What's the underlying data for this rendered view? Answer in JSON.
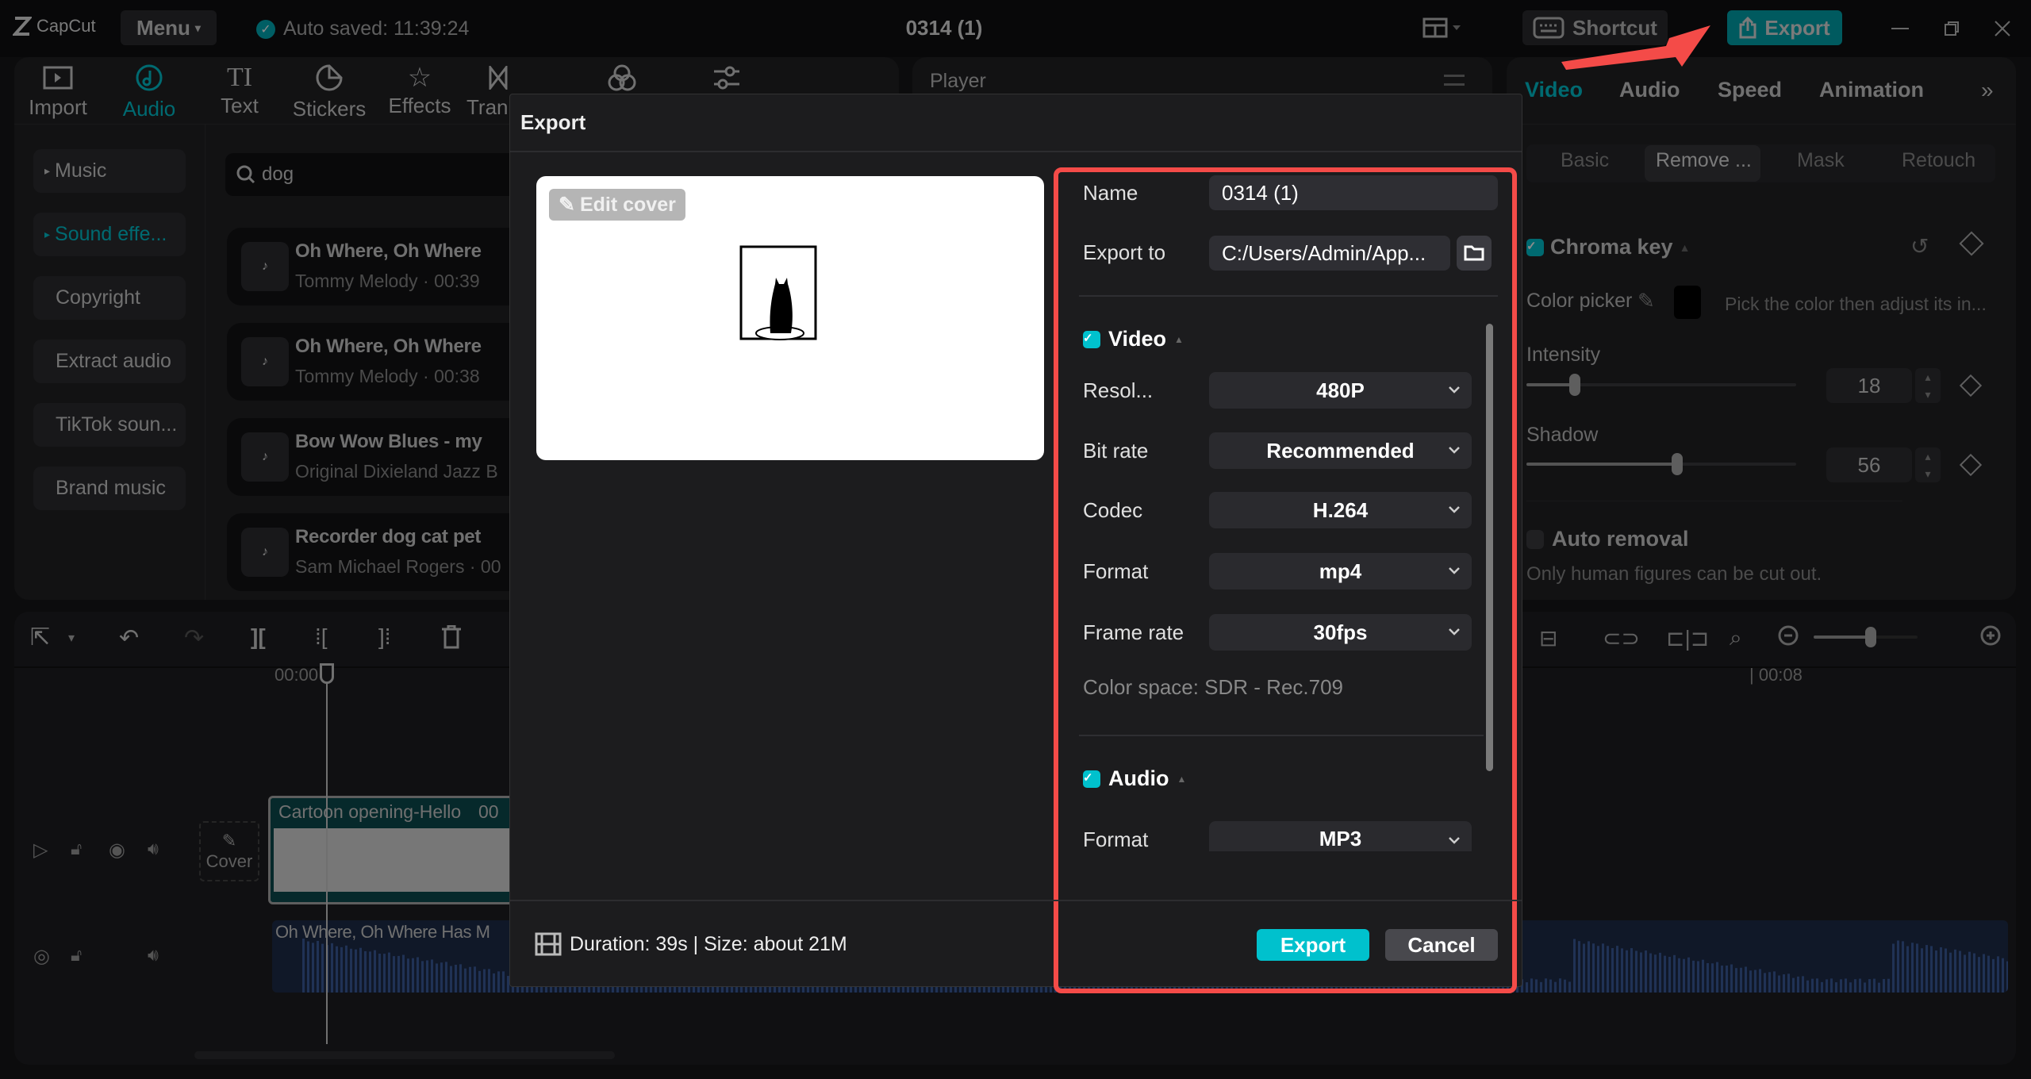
{
  "app": {
    "logo": "CapCut",
    "menu_label": "Menu",
    "autosave": "Auto saved: 11:39:24",
    "project_title": "0314 (1)",
    "shortcut_label": "Shortcut",
    "export_label": "Export",
    "accent": "#00c1cd",
    "annotation_color": "#f44b48"
  },
  "toolbar_tabs": [
    {
      "label": "Import",
      "icon": "import-icon"
    },
    {
      "label": "Audio",
      "icon": "audio-icon",
      "active": true
    },
    {
      "label": "Text",
      "icon": "text-icon"
    },
    {
      "label": "Stickers",
      "icon": "stickers-icon"
    },
    {
      "label": "Effects",
      "icon": "effects-icon"
    },
    {
      "label": "Tran",
      "icon": "transitions-icon"
    },
    {
      "label": "",
      "icon": "filters-icon"
    },
    {
      "label": "",
      "icon": "adjust-icon"
    }
  ],
  "sidebar": {
    "items": [
      {
        "label": "Music"
      },
      {
        "label": "Sound effe...",
        "active": true
      },
      {
        "label": "Copyright"
      },
      {
        "label": "Extract audio"
      },
      {
        "label": "TikTok soun..."
      },
      {
        "label": "Brand music"
      }
    ]
  },
  "search": {
    "value": "dog"
  },
  "music_list": [
    {
      "title": "Oh Where, Oh Where",
      "subtitle": "Tommy Melody · 00:39"
    },
    {
      "title": "Oh Where, Oh Where",
      "subtitle": "Tommy Melody · 00:38"
    },
    {
      "title": "Bow Wow Blues  - my",
      "subtitle": "Original Dixieland Jazz B"
    },
    {
      "title": "Recorder dog cat pet",
      "subtitle": "Sam Michael Rogers · 00"
    }
  ],
  "player": {
    "label": "Player"
  },
  "right_panel": {
    "tabs": [
      "Video",
      "Audio",
      "Speed",
      "Animation"
    ],
    "subtabs": [
      "Basic",
      "Remove ...",
      "Mask",
      "Retouch"
    ],
    "chroma_key": "Chroma key",
    "color_picker": "Color picker",
    "picker_hint": "Pick the color then adjust its in...",
    "intensity_label": "Intensity",
    "intensity": 18,
    "shadow_label": "Shadow",
    "shadow": 56,
    "auto_removal": "Auto removal",
    "auto_note": "Only human figures can be cut out."
  },
  "timeline": {
    "ruler_start": "00:00",
    "ruler_mark": "| 00:08",
    "cover_label": "Cover",
    "video_clip": "Cartoon opening-Hello",
    "video_clip_time": "00",
    "audio_clip": "Oh Where, Oh Where Has M",
    "zoom_level": 0.55
  },
  "dialog": {
    "title": "Export",
    "edit_cover": "Edit cover",
    "name_label": "Name",
    "name_value": "0314 (1)",
    "export_to_label": "Export to",
    "export_to_value": "C:/Users/Admin/App...",
    "video_section": "Video",
    "video_fields": [
      {
        "label": "Resol...",
        "value": "480P"
      },
      {
        "label": "Bit rate",
        "value": "Recommended"
      },
      {
        "label": "Codec",
        "value": "H.264"
      },
      {
        "label": "Format",
        "value": "mp4"
      },
      {
        "label": "Frame rate",
        "value": "30fps"
      }
    ],
    "color_space": "Color space: SDR - Rec.709",
    "audio_section": "Audio",
    "audio_format_label": "Format",
    "audio_format_value": "MP3",
    "summary": "Duration: 39s | Size: about 21M",
    "export_button": "Export",
    "cancel_button": "Cancel"
  }
}
